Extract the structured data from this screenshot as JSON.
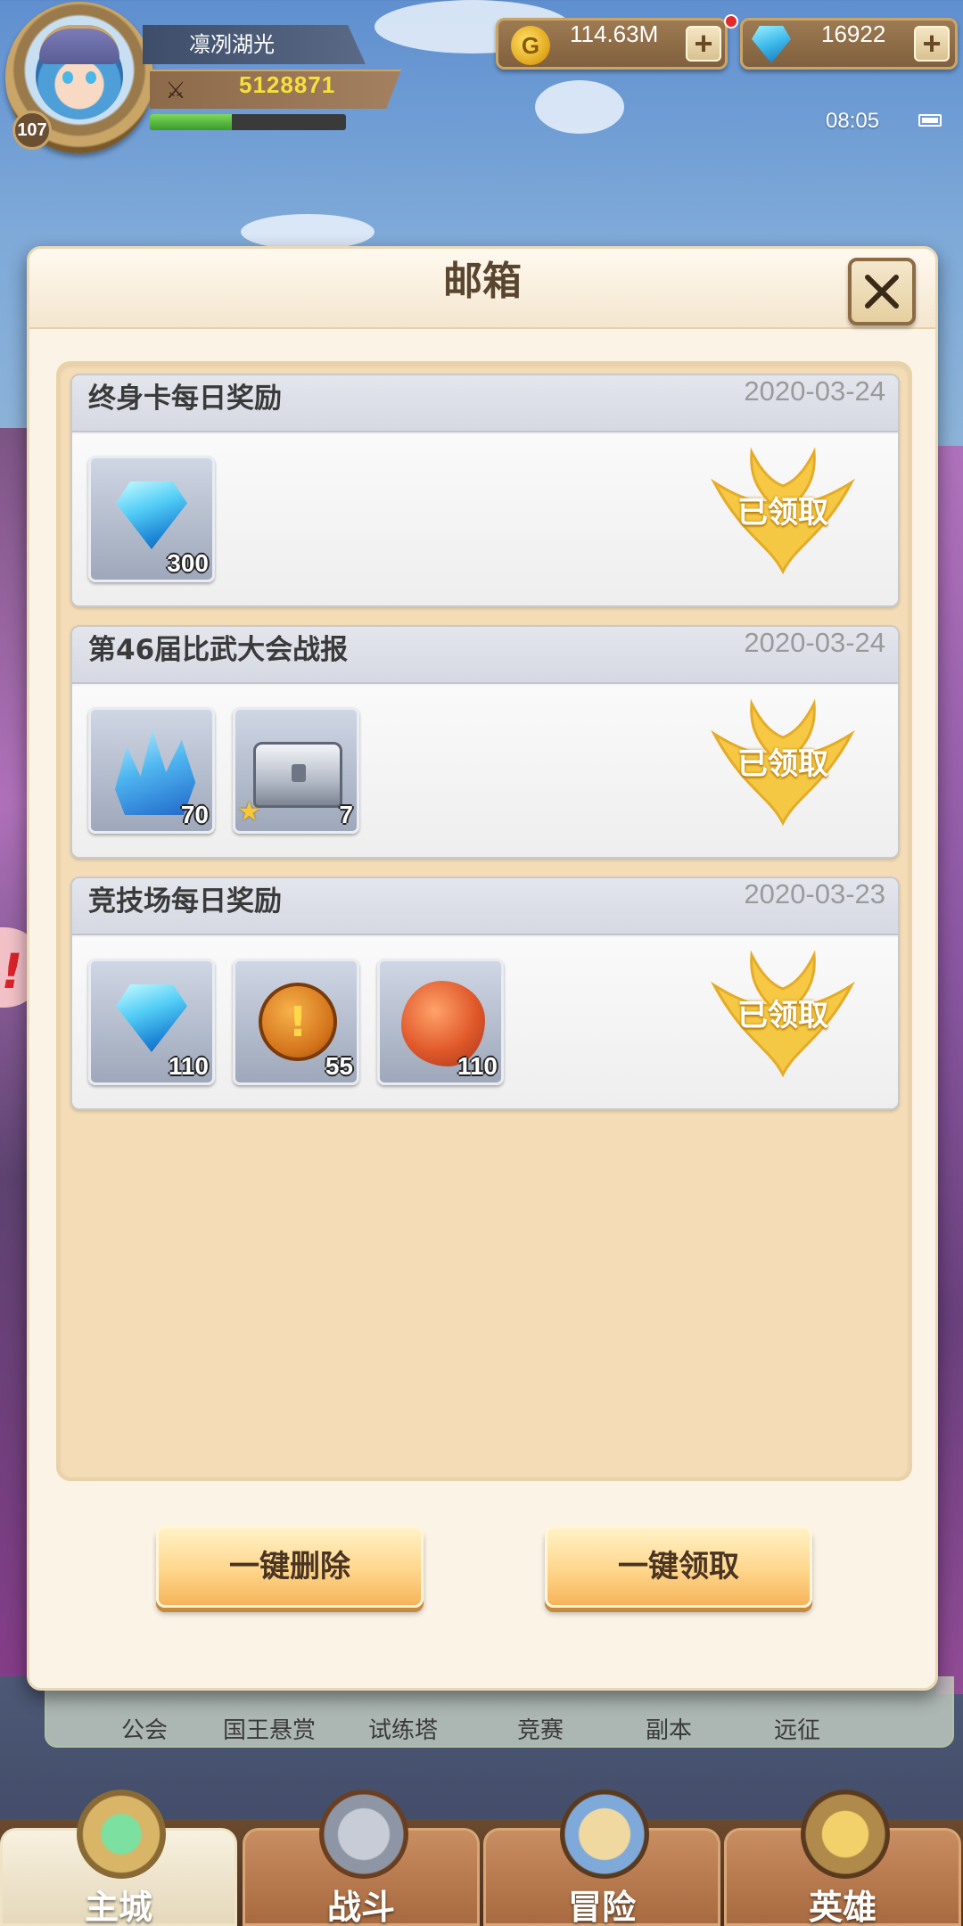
{
  "player": {
    "name": "凛冽湖光",
    "level": "107",
    "power": "5128871",
    "xp_fraction": 0.42
  },
  "resources": {
    "gold": "114.63M",
    "gems": "16922",
    "gold_icon": "gold-coin-icon",
    "gem_icon": "diamond-icon",
    "plus_label": "+"
  },
  "status": {
    "time": "08:05"
  },
  "mailbox": {
    "title": "邮箱",
    "close_icon": "close-x-icon",
    "mails": [
      {
        "title": "终身卡每日奖励",
        "date": "2020-03-24",
        "status": "已领取",
        "items": [
          {
            "icon": "diamond-icon",
            "qty": "300"
          }
        ]
      },
      {
        "title": "第46届比武大会战报",
        "date": "2020-03-24",
        "status": "已领取",
        "items": [
          {
            "icon": "blue-crystal-icon",
            "qty": "70"
          },
          {
            "icon": "silver-chest-icon",
            "qty": "7",
            "star": "★"
          }
        ]
      },
      {
        "title": "竞技场每日奖励",
        "date": "2020-03-23",
        "status": "已领取",
        "items": [
          {
            "icon": "diamond-icon",
            "qty": "110"
          },
          {
            "icon": "bronze-coin-icon",
            "qty": "55"
          },
          {
            "icon": "orange-ore-icon",
            "qty": "110"
          }
        ]
      }
    ],
    "delete_all": "一键删除",
    "claim_all": "一键领取"
  },
  "menu": [
    "公会",
    "国王悬赏",
    "试练塔",
    "竞赛",
    "副本",
    "远征"
  ],
  "tabs": [
    {
      "label": "主城",
      "active": true
    },
    {
      "label": "战斗",
      "active": false
    },
    {
      "label": "冒险",
      "active": false
    },
    {
      "label": "英雄",
      "active": false
    }
  ],
  "colors": {
    "claimed_gold": "#f6c63b",
    "dialog_bg": "#fbf3e6",
    "button_orange": "#ffd68c"
  }
}
